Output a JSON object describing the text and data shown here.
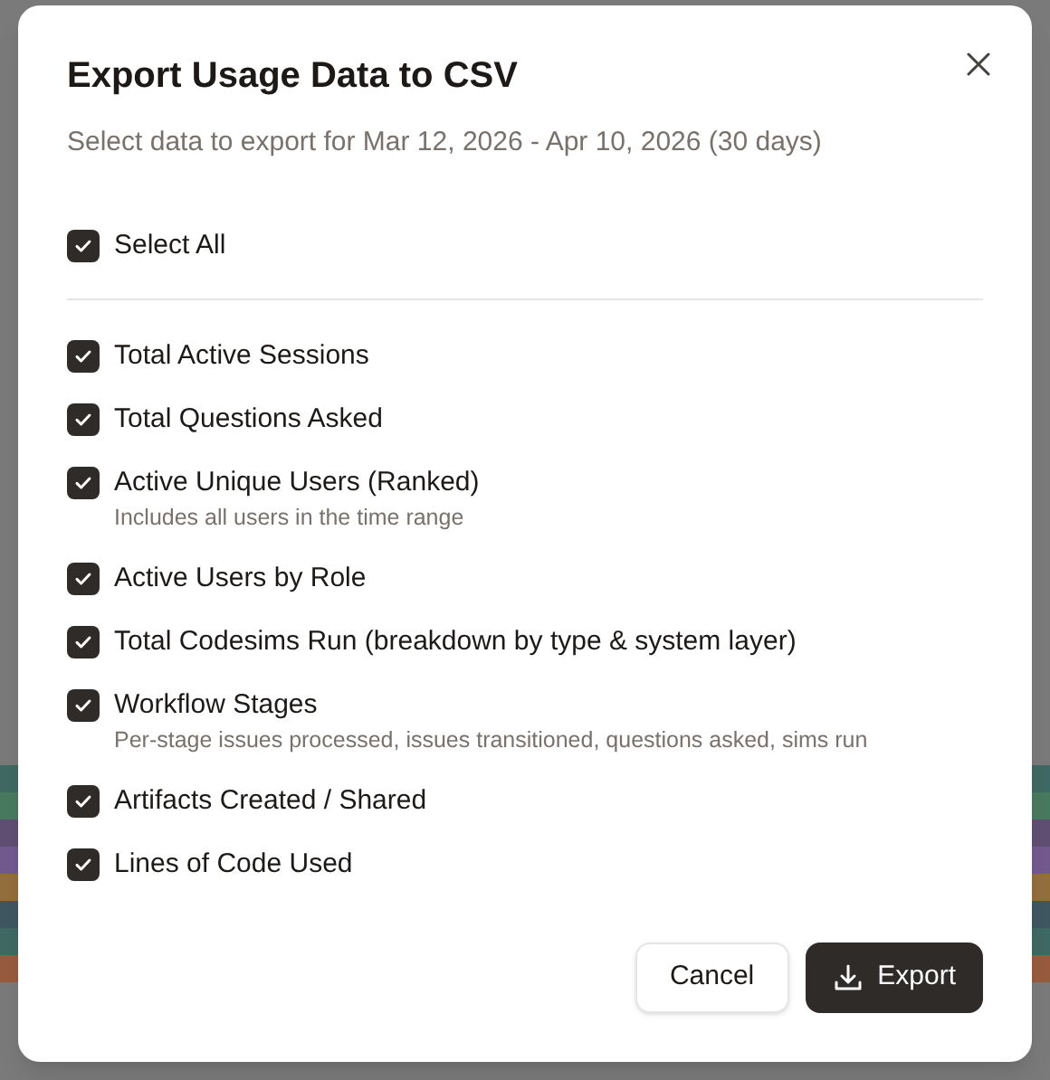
{
  "dialog": {
    "title": "Export Usage Data to CSV",
    "subtitle": "Select data to export for Mar 12, 2026 - Apr 10, 2026 (30 days)"
  },
  "select_all": {
    "label": "Select All",
    "checked": true
  },
  "options": [
    {
      "label": "Total Active Sessions",
      "checked": true
    },
    {
      "label": "Total Questions Asked",
      "checked": true
    },
    {
      "label": "Active Unique Users (Ranked)",
      "description": "Includes all users in the time range",
      "checked": true
    },
    {
      "label": "Active Users by Role",
      "checked": true
    },
    {
      "label": "Total Codesims Run (breakdown by type & system layer)",
      "checked": true
    },
    {
      "label": "Workflow Stages",
      "description": "Per-stage issues processed, issues transitioned, questions asked, sims run",
      "checked": true
    },
    {
      "label": "Artifacts Created / Shared",
      "checked": true
    },
    {
      "label": "Lines of Code Used",
      "checked": true
    }
  ],
  "buttons": {
    "cancel": "Cancel",
    "export": "Export"
  }
}
